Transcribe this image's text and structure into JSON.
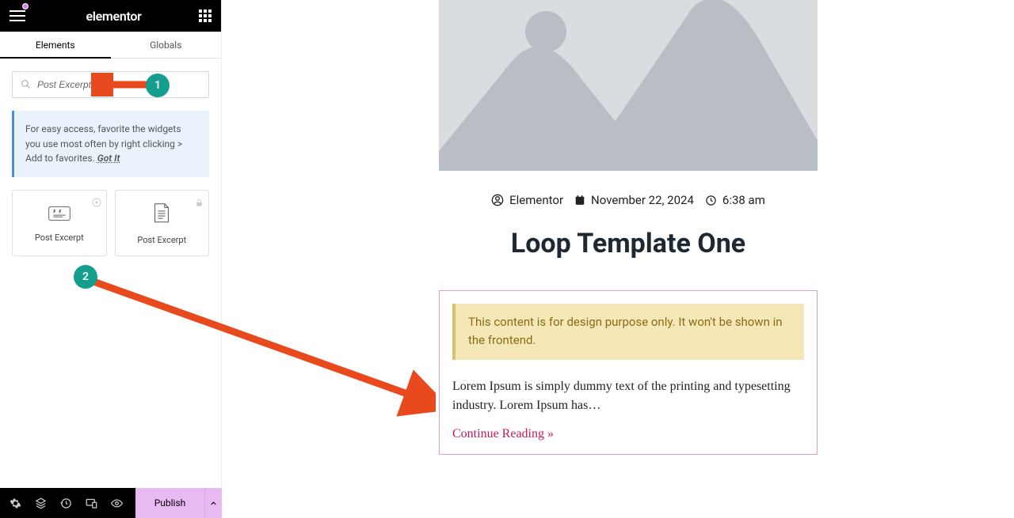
{
  "header": {
    "brand": "elementor"
  },
  "tabs": {
    "elements": "Elements",
    "globals": "Globals"
  },
  "search": {
    "value": "Post Excerpt"
  },
  "tip": {
    "text": "For easy access, favorite the widgets you use most often by right clicking > Add to favorites.",
    "got_it": "Got It"
  },
  "widgets": [
    {
      "label": "Post Excerpt"
    },
    {
      "label": "Post Excerpt"
    }
  ],
  "publish_label": "Publish",
  "canvas": {
    "meta": {
      "author": "Elementor",
      "date": "November 22, 2024",
      "time": "6:38 am"
    },
    "title": "Loop Template One",
    "notice": "This content is for design purpose only. It won't be shown in the frontend.",
    "excerpt": "Lorem Ipsum is simply dummy text of the printing and typesetting industry. Lorem Ipsum has…",
    "continue": "Continue Reading »"
  },
  "annotations": {
    "one": "1",
    "two": "2"
  }
}
